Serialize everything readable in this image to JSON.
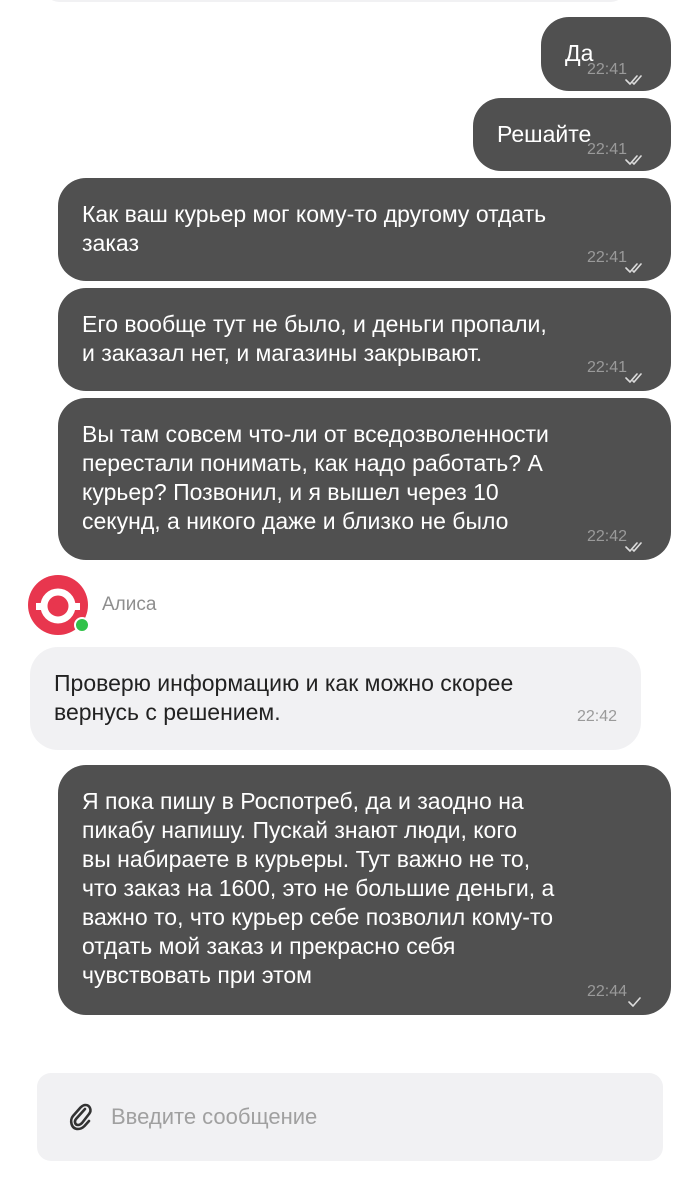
{
  "messages": [
    {
      "text": "Да",
      "time": "22:41"
    },
    {
      "text": "Решайте",
      "time": "22:41"
    },
    {
      "text": "Как ваш курьер мог кому-то другому отдать\nзаказ",
      "time": "22:41"
    },
    {
      "text": "Его вообще тут не было, и деньги пропали,\nи заказал нет, и магазины закрывают.",
      "time": "22:41"
    },
    {
      "text": "Вы там совсем что-ли от вседозволенности\nперестали понимать, как надо работать? А\nкурьер? Позвонил, и я вышел через 10\nсекунд, а никого даже и близко не было",
      "time": "22:42"
    },
    {
      "text": "Проверю информацию и как можно скорее\nвернусь с решением.",
      "time": "22:42"
    },
    {
      "text": "Я пока пишу в Роспотреб, да и заодно на\nпикабу напишу. Пускай знают люди, кого\nвы набираете в курьеры. Тут важно не то,\nчто заказ на 1600, это не большие деньги, а\nважно то, что курьер себе позволил кому-то\nотдать мой заказ и прекрасно себя\nчувствовать при этом",
      "time": "22:44"
    }
  ],
  "sender": {
    "name": "Алиса",
    "avatar_icon": "alisa-logo-icon",
    "status": "online"
  },
  "composer": {
    "placeholder": "Введите сообщение",
    "attach_icon": "paperclip-icon"
  },
  "colors": {
    "outgoing_bubble": "#505050",
    "incoming_bubble": "#f1f1f3",
    "brand": "#e8364e",
    "online": "#31c24a"
  }
}
